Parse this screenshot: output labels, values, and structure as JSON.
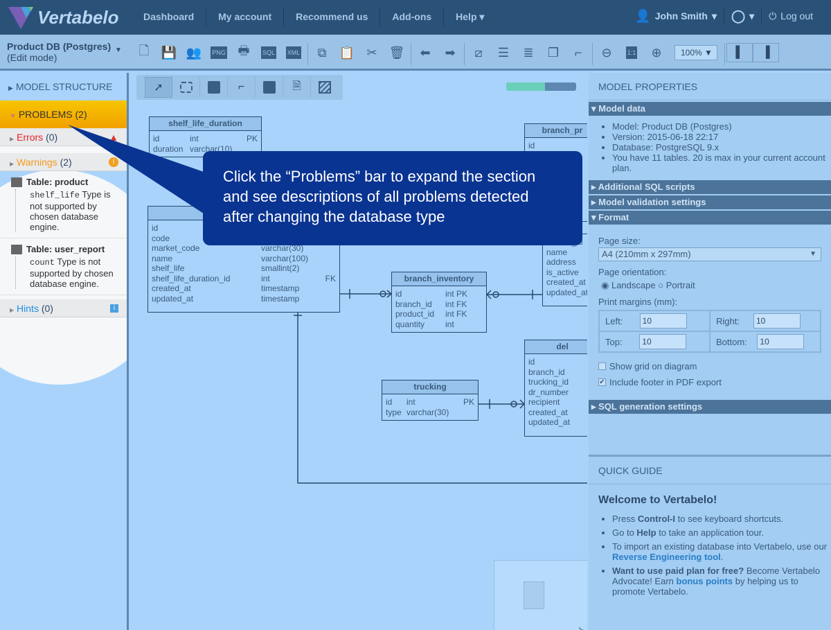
{
  "header": {
    "logo": "Vertabelo",
    "nav": [
      "Dashboard",
      "My account",
      "Recommend us",
      "Add-ons",
      "Help"
    ],
    "user": "John Smith",
    "logout": "Log out"
  },
  "toolbar": {
    "model_name": "Product DB (Postgres)",
    "mode": "(Edit mode)",
    "zoom": "100%",
    "icons": [
      "new-document-icon",
      "save-icon",
      "share-icon",
      "png-export-icon",
      "print-icon",
      "sql-export-icon",
      "xml-export-icon",
      "copy-icon",
      "paste-icon",
      "cut-icon",
      "delete-icon",
      "undo-icon",
      "redo-icon",
      "line-icon",
      "align-icon",
      "distribute-icon",
      "arrange-icon",
      "connector-icon",
      "zoom-out-icon",
      "actual-size-icon",
      "zoom-in-icon"
    ]
  },
  "left": {
    "model_structure": "MODEL STRUCTURE",
    "problems": "PROBLEMS (2)",
    "errors_label": "Errors",
    "errors_count": "(0)",
    "warnings_label": "Warnings",
    "warnings_count": "(2)",
    "hints_label": "Hints",
    "hints_count": "(0)",
    "issues": [
      {
        "table": "Table: product",
        "column": "shelf_life",
        "message": "Type is not supported by chosen database engine."
      },
      {
        "table": "Table: user_report",
        "column": "count",
        "message": "Type is not supported by chosen database engine."
      }
    ]
  },
  "canvas": {
    "progress_percent": 55,
    "tables": [
      {
        "name": "shelf_life_duration",
        "rows": [
          [
            "id",
            "int",
            "PK"
          ],
          [
            "duration",
            "varchar(10)",
            ""
          ]
        ]
      },
      {
        "name": "",
        "rows": [
          [
            "id",
            "",
            ""
          ],
          [
            "code",
            "",
            ""
          ],
          [
            "market_code",
            "varchar(30)",
            ""
          ],
          [
            "name",
            "varchar(100)",
            ""
          ],
          [
            "shelf_life",
            "smallint(2)",
            ""
          ],
          [
            "shelf_life_duration_id",
            "int",
            "FK"
          ],
          [
            "created_at",
            "timestamp",
            ""
          ],
          [
            "updated_at",
            "timestamp",
            ""
          ]
        ]
      },
      {
        "name": "branch_inventory",
        "rows": [
          [
            "id",
            "int PK",
            ""
          ],
          [
            "branch_id",
            "int FK",
            ""
          ],
          [
            "product_id",
            "int FK",
            ""
          ],
          [
            "quantity",
            "int",
            ""
          ]
        ]
      },
      {
        "name": "trucking",
        "rows": [
          [
            "id",
            "int",
            "PK"
          ],
          [
            "type",
            "varchar(30)",
            ""
          ]
        ]
      },
      {
        "name": "branch_pr",
        "rows": [
          [
            "id",
            "",
            ""
          ]
        ]
      },
      {
        "name": "",
        "rows": [
          [
            "retailer_id",
            "",
            ""
          ],
          [
            "name",
            "",
            ""
          ],
          [
            "address",
            "",
            ""
          ],
          [
            "is_active",
            "",
            ""
          ],
          [
            "created_at",
            "",
            ""
          ],
          [
            "updated_at",
            "",
            ""
          ]
        ]
      },
      {
        "name": "del",
        "rows": [
          [
            "id",
            "",
            ""
          ],
          [
            "branch_id",
            "",
            ""
          ],
          [
            "trucking_id",
            "",
            ""
          ],
          [
            "dr_number",
            "",
            ""
          ],
          [
            "recipient",
            "",
            ""
          ],
          [
            "created_at",
            "",
            ""
          ],
          [
            "updated_at",
            "",
            ""
          ]
        ]
      }
    ]
  },
  "callout": "Click the “Problems” bar to expand the section and see descriptions of all problems detected after changing the database type",
  "right": {
    "title": "MODEL PROPERTIES",
    "model_data": "Model data",
    "info": [
      "Model: Product DB (Postgres)",
      "Version: 2015-06-18 22:17",
      "Database: PostgreSQL 9.x",
      "You have 11 tables. 20 is max in your current account plan."
    ],
    "sections": [
      "Additional SQL scripts",
      "Model validation settings",
      "Format",
      "SQL generation settings"
    ],
    "page_size_label": "Page size:",
    "page_size": "A4 (210mm x 297mm)",
    "orientation_label": "Page orientation:",
    "landscape": "Landscape",
    "portrait": "Portrait",
    "margins_label": "Print margins (mm):",
    "margins": [
      {
        "label": "Left:",
        "value": "10"
      },
      {
        "label": "Right:",
        "value": "10"
      },
      {
        "label": "Top:",
        "value": "10"
      },
      {
        "label": "Bottom:",
        "value": "10"
      }
    ],
    "show_grid": "Show grid on diagram",
    "show_grid_checked": false,
    "footer": "Include footer in PDF export",
    "footer_checked": true
  },
  "guide": {
    "title": "QUICK GUIDE",
    "welcome": "Welcome to Vertabelo!",
    "items": [
      {
        "a": "Press ",
        "b": "Control-I",
        "c": " to see keyboard shortcuts."
      },
      {
        "a": "Go to ",
        "b": "Help",
        "c": " to take an application tour."
      },
      {
        "a": "To import an existing database into Vertabelo, use our ",
        "link": "Reverse Engineering tool",
        "c": "."
      },
      {
        "b": "Want to use paid plan for free?",
        "a": " Become Vertabelo Advocate! Earn ",
        "link": "bonus points",
        "c": " by helping us to promote Vertabelo."
      }
    ]
  }
}
